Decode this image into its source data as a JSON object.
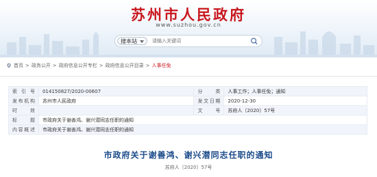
{
  "header": {
    "site_title": "苏州市人民政府",
    "site_url": "www.suzhou.gov.cn"
  },
  "search": {
    "scope_label": "搜本站",
    "placeholder": "请输入关键词"
  },
  "breadcrumb": [
    "首页",
    ">",
    "政务公开",
    ">",
    "政府信息公开专栏",
    ">",
    "政府信息公开目录",
    ">",
    "人事任免"
  ],
  "meta": {
    "index_no_label": "索引号",
    "index_no": "014150827/2020-00607",
    "category_label": "分类",
    "category": "人事工作；人事任免；通知",
    "publisher_label": "发布机构",
    "publisher": "苏州市人民政府",
    "date_label": "发文日期",
    "date": "2020-12-30",
    "validity_label": "时效",
    "validity": "",
    "doc_no_label": "文号",
    "doc_no": "苏府人〔2020〕57号",
    "title_label": "标题",
    "title": "市政府关于谢善鸿、谢兴潜同志任职的通知",
    "content_label": "内容概述",
    "content": "市政府关于谢善鸿、谢兴潜同志任职的通知"
  },
  "document": {
    "title": "市政府关于谢善鸿、谢兴潜同志任职的通知",
    "number": "苏府人〔2020〕57号"
  },
  "colors": {
    "brand_red": "#c8161d",
    "title_blue": "#1a4a8a",
    "label_bg": "#f1f5fb"
  }
}
